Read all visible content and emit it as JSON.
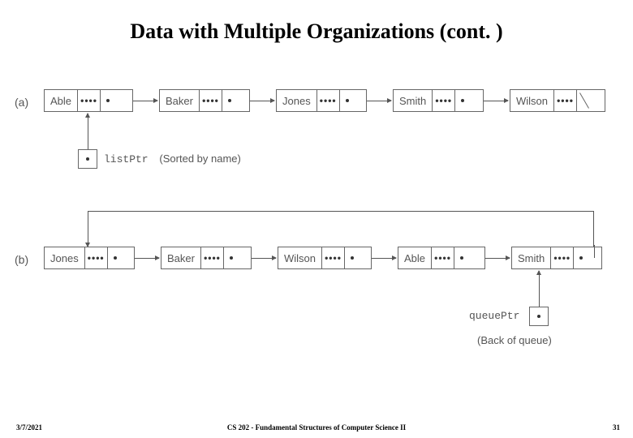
{
  "title": "Data with Multiple Organizations (cont. )",
  "footer": {
    "date": "3/7/2021",
    "course": "CS 202 - Fundamental Structures of Computer Science II",
    "page": "31"
  },
  "diagram": {
    "rowA": {
      "label": "(a)",
      "nodes": [
        "Able",
        "Baker",
        "Jones",
        "Smith",
        "Wilson"
      ],
      "pointer": {
        "name": "listPtr",
        "annotation": "(Sorted by name)"
      }
    },
    "rowB": {
      "label": "(b)",
      "nodes": [
        "Jones",
        "Baker",
        "Wilson",
        "Able",
        "Smith"
      ],
      "pointer": {
        "name": "queuePtr",
        "annotation": "(Back of queue)"
      }
    }
  },
  "glyphs": {
    "dots": "••••"
  }
}
